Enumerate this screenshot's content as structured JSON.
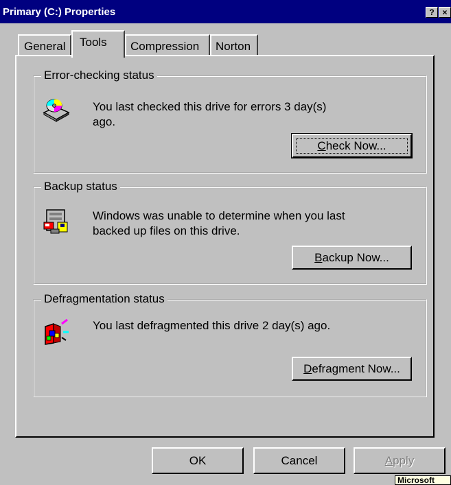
{
  "window": {
    "title": "Primary (C:) Properties",
    "help_btn": "?",
    "close_btn": "×"
  },
  "tabs": [
    {
      "label": "General"
    },
    {
      "label": "Tools"
    },
    {
      "label": "Compression"
    },
    {
      "label": "Norton"
    }
  ],
  "error_check": {
    "legend": "Error-checking status",
    "line1": "You last checked this drive for errors 3 day(s)",
    "line2": "ago.",
    "button_mnemonic": "C",
    "button_rest": "heck Now...",
    "icon": "disk-check-icon"
  },
  "backup": {
    "legend": "Backup status",
    "line1": "Windows was unable to determine when you last",
    "line2": "backed up files on this drive.",
    "button_mnemonic": "B",
    "button_rest": "ackup Now...",
    "icon": "backup-icon"
  },
  "defrag": {
    "legend": "Defragmentation status",
    "line1": "You last defragmented this drive 2 day(s) ago.",
    "button_mnemonic": "D",
    "button_rest": "efragment Now...",
    "icon": "defrag-icon"
  },
  "footer": {
    "ok": "OK",
    "cancel": "Cancel",
    "apply_mnemonic": "A",
    "apply_rest": "pply"
  },
  "tooltip": "Microsoft",
  "colors": {
    "titlebar": "#000080",
    "face": "#c0c0c0"
  }
}
